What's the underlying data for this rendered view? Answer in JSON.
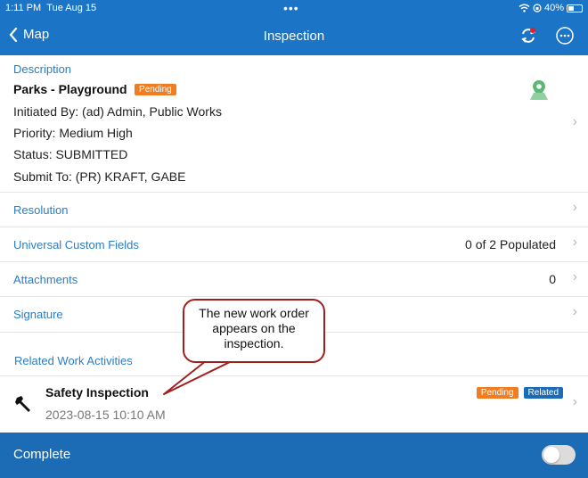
{
  "status_bar": {
    "time": "1:11 PM",
    "date": "Tue Aug 15",
    "battery": "40%"
  },
  "nav": {
    "back_label": "Map",
    "title": "Inspection",
    "sync_icon": "sync-icon",
    "more_icon": "more-icon"
  },
  "description": {
    "header": "Description",
    "title": "Parks - Playground",
    "badge": "Pending",
    "initiated_by": "Initiated By: (ad) Admin, Public Works",
    "priority": "Priority: Medium High",
    "status": "Status: SUBMITTED",
    "submit_to": "Submit To: (PR) KRAFT, GABE",
    "map_icon": "map-pin-icon"
  },
  "rows": {
    "resolution": "Resolution",
    "custom_fields": "Universal Custom Fields",
    "custom_fields_value": "0 of 2 Populated",
    "attachments": "Attachments",
    "attachments_value": "0",
    "signature": "Signature"
  },
  "related": {
    "header": "Related Work Activities",
    "item": {
      "title": "Safety Inspection",
      "datetime": "2023-08-15 10:10 AM",
      "badge_status": "Pending",
      "badge_related": "Related",
      "icon": "wrench-icon"
    }
  },
  "footer": {
    "label": "Complete"
  },
  "callout": {
    "text": "The new work order appears on the inspection."
  },
  "colors": {
    "primary": "#1b74c5",
    "accent_blue": "#2a7dc7",
    "pending": "#f07d22",
    "callout_border": "#a02020"
  }
}
